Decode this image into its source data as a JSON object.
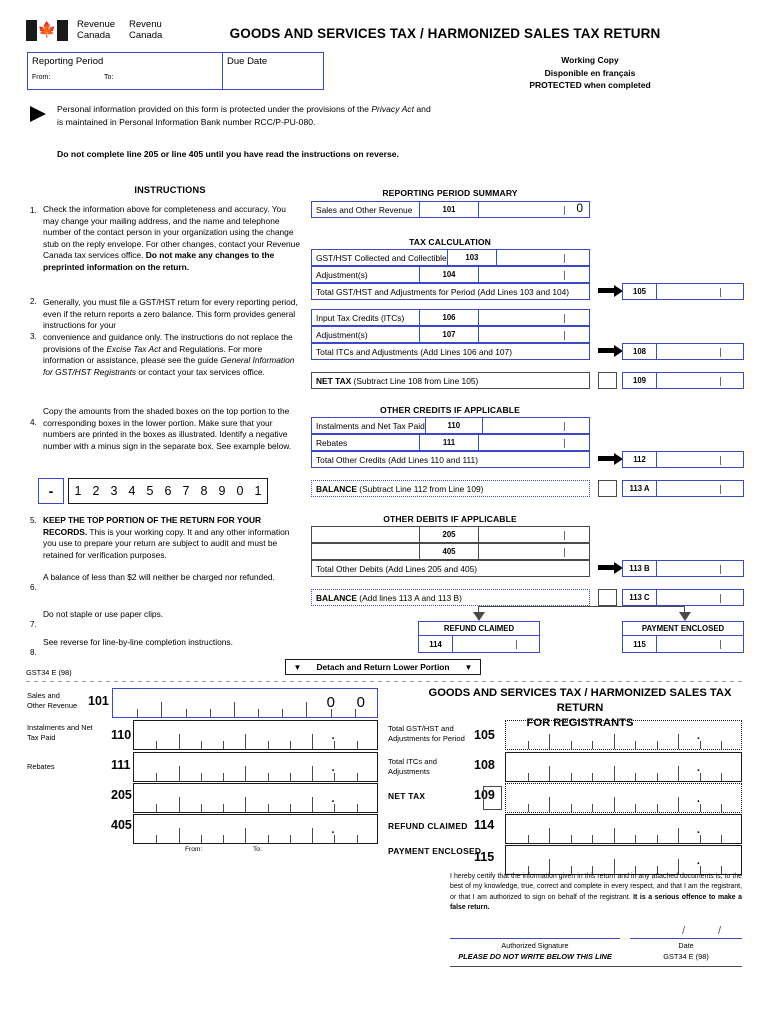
{
  "header": {
    "dept_en_line1": "Revenue",
    "dept_en_line2": "Canada",
    "dept_fr_line1": "Revenu",
    "dept_fr_line2": "Canada",
    "form_title": "GOODS AND SERVICES TAX / HARMONIZED SALES TAX  RETURN",
    "reporting_period_label": "Reporting Period",
    "from_label": "From:",
    "to_label": "To:",
    "due_date_label": "Due Date",
    "working_copy": "Working Copy",
    "disponible": "Disponible en français",
    "protected": "PROTECTED when completed"
  },
  "privacy": {
    "line1": "Personal information provided on this form is protected under the provisions of the ",
    "act": "Privacy Act",
    "line1b": " and",
    "line2": "is maintained in Personal Information Bank number RCC/P-PU-080.",
    "warning": "Do not complete line 205 or line 405 until you have read the instructions on reverse."
  },
  "instructions": {
    "heading": "INSTRUCTIONS",
    "items": [
      {
        "num": "1.",
        "text": "Check the information above for completeness and accuracy. You may change your mailing  address, and the name and telephone number of the contact person in your organization using the change stub on the reply envelope. For other changes, contact your Revenue Canada tax services office. ",
        "bold": "Do not make any changes to the preprinted information on the return."
      },
      {
        "num": "2.",
        "text": "Generally, you must file a GST/HST return for every reporting period, even if the return reports a zero balance. This form provides general instructions for your"
      },
      {
        "num": "3.",
        "text": "convenience and guidance only. The instructions do not replace the provisions of the ",
        "italic1": "Excise Tax Act",
        "text2": " and Regulations. For more information or assistance, please see the guide ",
        "italic2": "General Information for GST/HST Registrants",
        "text3": " or contact your tax services office."
      },
      {
        "num": "4.",
        "text": "Copy the amounts from the shaded boxes on the top portion to the corresponding boxes in the lower portion. Make sure that your numbers are printed in the boxes as illustrated. Identify a negative number with a minus sign in the separate box.  See example below."
      },
      {
        "num": "5.",
        "bold": "KEEP THE TOP PORTION OF THE RETURN FOR YOUR RECORDS.",
        "text": " This is your working copy. It and any other information you use to prepare your return are subject to audit and must be retained for verification purposes."
      },
      {
        "num": "6.",
        "text": "A balance of less than $2 will neither be charged nor refunded."
      },
      {
        "num": "7.",
        "text": "Do not staple or use paper clips."
      },
      {
        "num": "8.",
        "text": "See reverse for line-by-line completion instructions."
      }
    ],
    "example": {
      "minus": "-",
      "digits": [
        "1",
        "2",
        "3",
        "4",
        "5",
        "6",
        "7",
        "8",
        "9",
        "0",
        "1"
      ]
    }
  },
  "summary": {
    "heading": "REPORTING PERIOD SUMMARY",
    "row": {
      "label": "Sales and Other Revenue",
      "line": "101",
      "zero": "0"
    }
  },
  "tax_calculation": {
    "heading": "TAX CALCULATION",
    "rows": [
      {
        "label": "GST/HST Collected and Collectible",
        "line": "103"
      },
      {
        "label": "Adjustment(s)",
        "line": "104"
      }
    ],
    "total_label": "Total GST/HST and Adjustments for Period (Add Lines 103 and 104)",
    "total_line": "105"
  },
  "itc": {
    "rows": [
      {
        "label": "Input Tax Credits (ITCs)",
        "line": "106"
      },
      {
        "label": "Adjustment(s)",
        "line": "107"
      }
    ],
    "total_label": "Total ITCs and Adjustments (Add Lines 106 and 107)",
    "total_line": "108"
  },
  "net_tax": {
    "bold": "NET TAX",
    "rest": " (Subtract Line 108 from Line 105)",
    "line": "109"
  },
  "other_credits": {
    "heading": "OTHER CREDITS IF APPLICABLE",
    "rows": [
      {
        "label": "Instalments and Net Tax Paid",
        "line": "110"
      },
      {
        "label": "Rebates",
        "line": "111"
      }
    ],
    "total_label": "Total Other Credits (Add Lines 110 and 111)",
    "total_line": "112",
    "balance_bold": "BALANCE",
    "balance_rest": " (Subtract Line 112 from Line 109)",
    "balance_line": "113 A"
  },
  "other_debits": {
    "heading": "OTHER DEBITS IF APPLICABLE",
    "rows": [
      {
        "label": "",
        "line": "205"
      },
      {
        "label": "",
        "line": "405"
      }
    ],
    "total_label": "Total Other Debits (Add Lines 205 and 405)",
    "total_line": "113 B",
    "balance_bold": "BALANCE",
    "balance_rest": " (Add lines 113 A and 113 B)",
    "balance_line": "113 C"
  },
  "refund_payment": {
    "refund_caption": "REFUND CLAIMED",
    "refund_line": "114",
    "payment_caption": "PAYMENT ENCLOSED",
    "payment_line": "115"
  },
  "detach": {
    "left_tri": "▼",
    "text": "Detach and Return Lower Portion",
    "right_tri": "▼",
    "form_code": "GST34 E (98)"
  },
  "lower": {
    "title_line1": "GOODS AND SERVICES TAX / HARMONIZED SALES TAX RETURN",
    "title_line2": "FOR REGISTRANTS",
    "left_rows": [
      {
        "label": "Sales and\nOther Revenue",
        "line": "101"
      },
      {
        "label": "Instalments and Net\nTax Paid",
        "line": "110"
      },
      {
        "label": "Rebates",
        "line": "111"
      },
      {
        "label": "",
        "line": "205"
      },
      {
        "label": "",
        "line": "405"
      }
    ],
    "right_rows": [
      {
        "label": "Total GST/HST and\nAdjustments for Period",
        "line": "105"
      },
      {
        "label": "Total ITCs and\nAdjustments",
        "line": "108"
      },
      {
        "label": "NET  TAX",
        "line": "109"
      },
      {
        "label": "REFUND  CLAIMED",
        "line": "114"
      },
      {
        "label": "PAYMENT ENCLOSED",
        "line": "115"
      }
    ],
    "from_label": "From:",
    "to_label": "To:",
    "line101_zeros": [
      "0",
      "0"
    ]
  },
  "certification": {
    "text": "I hereby certify that the information given in this return and in any attached documents is, to the best of my knowledge, true, correct and complete in every respect, and that I am the registrant, or that I am authorized to sign on behalf of the registrant. ",
    "bold": "It is a serious offence to make a false return.",
    "signature_label": "Authorized Signature",
    "date_label": "Date",
    "no_write": "PLEASE DO NOT WRITE BELOW THIS LINE",
    "form_code": "GST34 E (98)",
    "slash": "/"
  },
  "colors": {
    "blue_rule": "#3a49c9",
    "dark_rule": "#4a4a4a",
    "text": "#000000"
  }
}
